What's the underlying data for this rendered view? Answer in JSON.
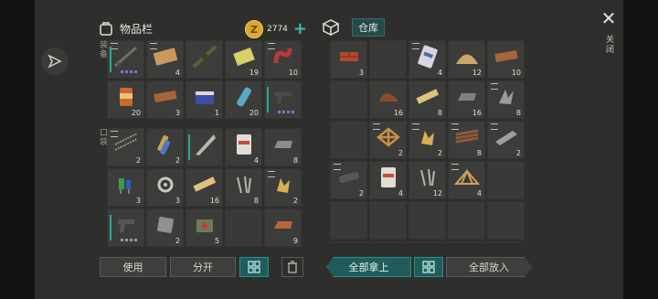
{
  "inventory": {
    "title": "物品栏",
    "coins": "2774",
    "side_top": "装备",
    "side_bottom": "口袋",
    "top_slots": [
      {
        "icon": "rifle-icon",
        "qty": "",
        "stack": true,
        "bar": true,
        "dots": "purple"
      },
      {
        "icon": "planks-icon",
        "qty": "4",
        "stack": true
      },
      {
        "icon": "assault-rifle-icon",
        "qty": "",
        "stack": false
      },
      {
        "icon": "battery-pack-icon",
        "qty": "19",
        "stack": false
      },
      {
        "icon": "red-hose-icon",
        "qty": "10",
        "stack": true
      },
      {
        "icon": "canned-food-icon",
        "qty": "20",
        "stack": false
      },
      {
        "icon": "plank-icon",
        "qty": "3",
        "stack": false
      },
      {
        "icon": "car-battery-icon",
        "qty": "1",
        "stack": false
      },
      {
        "icon": "water-bottle-icon",
        "qty": "20",
        "stack": false
      },
      {
        "icon": "pistol-icon",
        "qty": "",
        "stack": false,
        "bar": true,
        "dots": "purple"
      }
    ],
    "bottom_slots": [
      {
        "icon": "rebar-icon",
        "qty": "2",
        "stack": true
      },
      {
        "icon": "ammo-shells-icon",
        "qty": "2",
        "stack": false
      },
      {
        "icon": "machete-icon",
        "qty": "",
        "stack": false,
        "bar": true
      },
      {
        "icon": "cement-bag-icon",
        "qty": "4",
        "stack": false
      },
      {
        "icon": "metal-ingot-icon",
        "qty": "8",
        "stack": false
      },
      {
        "icon": "electronic-parts-icon",
        "qty": "3",
        "stack": false
      },
      {
        "icon": "mechanism-icon",
        "qty": "3",
        "stack": false
      },
      {
        "icon": "wood-plank-icon",
        "qty": "16",
        "stack": false
      },
      {
        "icon": "nails-icon",
        "qty": "8",
        "stack": false
      },
      {
        "icon": "gold-parts-icon",
        "qty": "2",
        "stack": true
      },
      {
        "icon": "handgun-icon",
        "qty": "",
        "stack": false,
        "bar": true,
        "dots": "gray"
      },
      {
        "icon": "metal-plate-icon",
        "qty": "2",
        "stack": false
      },
      {
        "icon": "medkit-icon",
        "qty": "5",
        "stack": false
      },
      {
        "icon": "",
        "qty": "",
        "stack": false
      },
      {
        "icon": "copper-ingot-icon",
        "qty": "9",
        "stack": false
      }
    ]
  },
  "warehouse": {
    "title": "仓库",
    "slots": [
      {
        "icon": "brick-icon",
        "qty": "3",
        "stack": false
      },
      {
        "icon": "",
        "qty": "",
        "stack": false
      },
      {
        "icon": "sand-bag-icon",
        "qty": "4",
        "stack": true
      },
      {
        "icon": "sand-pile-icon",
        "qty": "12",
        "stack": false
      },
      {
        "icon": "plank-icon",
        "qty": "10",
        "stack": false
      },
      {
        "icon": "",
        "qty": "",
        "stack": false
      },
      {
        "icon": "leather-icon",
        "qty": "16",
        "stack": false
      },
      {
        "icon": "wood-plank-icon",
        "qty": "8",
        "stack": false
      },
      {
        "icon": "steel-ingot-icon",
        "qty": "16",
        "stack": false
      },
      {
        "icon": "scrap-metal-icon",
        "qty": "8",
        "stack": true
      },
      {
        "icon": "",
        "qty": "",
        "stack": false
      },
      {
        "icon": "wooden-frame-icon",
        "qty": "2",
        "stack": true
      },
      {
        "icon": "gold-parts-icon",
        "qty": "2",
        "stack": true
      },
      {
        "icon": "wood-bundle-icon",
        "qty": "8",
        "stack": true
      },
      {
        "icon": "metal-sheet-icon",
        "qty": "2",
        "stack": true
      },
      {
        "icon": "pipe-icon",
        "qty": "2",
        "stack": true
      },
      {
        "icon": "cement-bag-icon",
        "qty": "4",
        "stack": false
      },
      {
        "icon": "nails-icon",
        "qty": "12",
        "stack": false
      },
      {
        "icon": "truss-icon",
        "qty": "4",
        "stack": true
      },
      {
        "icon": "",
        "qty": "",
        "stack": false
      },
      {
        "icon": "",
        "qty": "",
        "stack": false
      },
      {
        "icon": "",
        "qty": "",
        "stack": false
      },
      {
        "icon": "",
        "qty": "",
        "stack": false
      },
      {
        "icon": "",
        "qty": "",
        "stack": false
      },
      {
        "icon": "",
        "qty": "",
        "stack": false
      },
      {
        "icon": "",
        "qty": "",
        "stack": false
      },
      {
        "icon": "",
        "qty": "",
        "stack": false
      },
      {
        "icon": "",
        "qty": "",
        "stack": false
      },
      {
        "icon": "",
        "qty": "",
        "stack": false
      },
      {
        "icon": "",
        "qty": "",
        "stack": false
      }
    ]
  },
  "buttons": {
    "use": "使用",
    "split": "分开",
    "take_all": "全部拿上",
    "put_all": "全部放入"
  },
  "close_label": "关闭",
  "colors": {
    "accent": "#2a8f89",
    "coin": "#d9a92b",
    "rarity": "#8a6fd0"
  }
}
